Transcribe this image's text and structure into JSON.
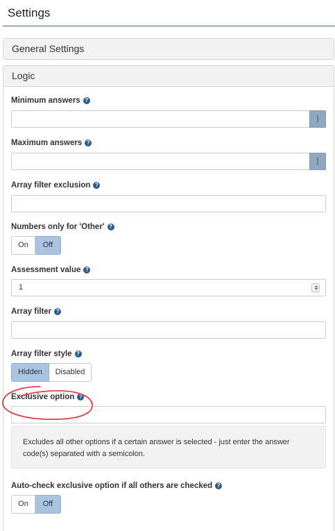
{
  "header": {
    "title": "Settings"
  },
  "panels": {
    "general_label": "General Settings",
    "logic_label": "Logic"
  },
  "fields": {
    "min_answers": {
      "label": "Minimum answers",
      "value": "",
      "addon": "}"
    },
    "max_answers": {
      "label": "Maximum answers",
      "value": "",
      "addon": "}"
    },
    "array_filter_exclusion": {
      "label": "Array filter exclusion",
      "value": ""
    },
    "numbers_only_other": {
      "label": "Numbers only for 'Other'",
      "options": [
        "On",
        "Off"
      ],
      "selected": "Off"
    },
    "assessment_value": {
      "label": "Assessment value",
      "value": "1"
    },
    "array_filter": {
      "label": "Array filter",
      "value": ""
    },
    "array_filter_style": {
      "label": "Array filter style",
      "options": [
        "Hidden",
        "Disabled"
      ],
      "selected": "Hidden"
    },
    "exclusive_option": {
      "label": "Exclusive option",
      "value": "",
      "help_text": "Excludes all other options if a certain answer is selected - just enter the answer code(s) separated with a semicolon."
    },
    "auto_check_exclusive": {
      "label": "Auto-check exclusive option if all others are checked",
      "options": [
        "On",
        "Off"
      ],
      "selected": "Off"
    }
  },
  "icons": {
    "help": "question-circle-icon",
    "spinner": "number-spinner-icon"
  },
  "colors": {
    "accent": "#2a5b8a",
    "toggle_active": "#a9c4e0",
    "annotation": "#e0282e",
    "header_rule": "#3b6e6e"
  }
}
